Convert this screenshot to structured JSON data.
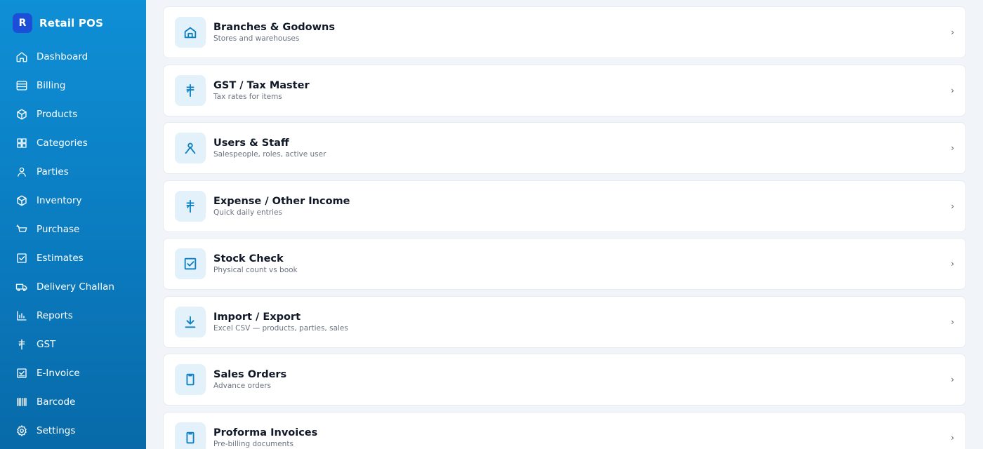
{
  "brand": {
    "logo_letter": "R",
    "name": "Retail POS"
  },
  "sidebar": {
    "items": [
      {
        "label": "Dashboard",
        "icon": "home-icon"
      },
      {
        "label": "Billing",
        "icon": "billing-icon"
      },
      {
        "label": "Products",
        "icon": "box-icon"
      },
      {
        "label": "Categories",
        "icon": "grid-icon"
      },
      {
        "label": "Parties",
        "icon": "user-icon"
      },
      {
        "label": "Inventory",
        "icon": "cube-icon"
      },
      {
        "label": "Purchase",
        "icon": "cart-icon"
      },
      {
        "label": "Estimates",
        "icon": "checkbox-icon"
      },
      {
        "label": "Delivery Challan",
        "icon": "truck-icon"
      },
      {
        "label": "Reports",
        "icon": "bar-chart-icon"
      },
      {
        "label": "GST",
        "icon": "rupee-icon"
      },
      {
        "label": "E-Invoice",
        "icon": "invoice-icon"
      },
      {
        "label": "Barcode",
        "icon": "barcode-icon"
      },
      {
        "label": "Settings",
        "icon": "gear-icon"
      }
    ]
  },
  "cards": [
    {
      "title": "Branches & Godowns",
      "subtitle": "Stores and warehouses",
      "icon": "home-icon"
    },
    {
      "title": "GST / Tax Master",
      "subtitle": "Tax rates for items",
      "icon": "rupee-icon"
    },
    {
      "title": "Users & Staff",
      "subtitle": "Salespeople, roles, active user",
      "icon": "user-icon"
    },
    {
      "title": "Expense / Other Income",
      "subtitle": "Quick daily entries",
      "icon": "rupee-icon"
    },
    {
      "title": "Stock Check",
      "subtitle": "Physical count vs book",
      "icon": "checkbox-icon"
    },
    {
      "title": "Import / Export",
      "subtitle": "Excel CSV — products, parties, sales",
      "icon": "download-icon"
    },
    {
      "title": "Sales Orders",
      "subtitle": "Advance orders",
      "icon": "document-icon"
    },
    {
      "title": "Proforma Invoices",
      "subtitle": "Pre-billing documents",
      "icon": "document-icon"
    }
  ],
  "chevron": "›",
  "colors": {
    "sidebar": "#0a79bd",
    "accent": "#0a7fc4",
    "icon_bg": "#e3f1fb"
  }
}
